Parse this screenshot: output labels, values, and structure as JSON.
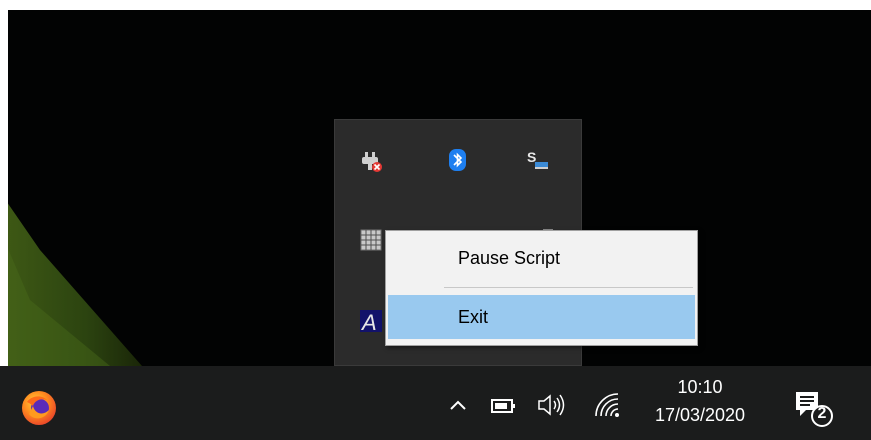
{
  "context_menu": {
    "items": [
      {
        "label": "Pause Script"
      },
      {
        "label": "Exit",
        "highlighted": true
      }
    ]
  },
  "tray_flyout": {
    "icons": [
      {
        "icon": "power-plug-error-icon"
      },
      {
        "icon": "bluetooth-icon"
      },
      {
        "icon": "synology-s-icon"
      },
      {
        "icon": "calculator-grid-icon"
      },
      {
        "icon": "partially-hidden-icon"
      },
      {
        "icon": "partially-hidden-icon"
      },
      {
        "icon": "autohotkey-a-icon"
      }
    ]
  },
  "taskbar": {
    "start_app": {
      "icon": "firefox-icon"
    },
    "show_hidden_icons": {
      "icon": "chevron-up-icon"
    },
    "battery": {
      "icon": "battery-icon"
    },
    "volume": {
      "icon": "speaker-icon"
    },
    "network": {
      "icon": "wifi-icon"
    },
    "clock": {
      "time": "10:10",
      "date": "17/03/2020"
    },
    "notifications": {
      "icon": "action-center-icon",
      "count": "2"
    }
  },
  "colors": {
    "menu_highlight": "#99c9ef",
    "taskbar_bg": "#1b1c1c",
    "flyout_bg": "#2b2b2b",
    "bluetooth_blue": "#1e7ff0"
  }
}
